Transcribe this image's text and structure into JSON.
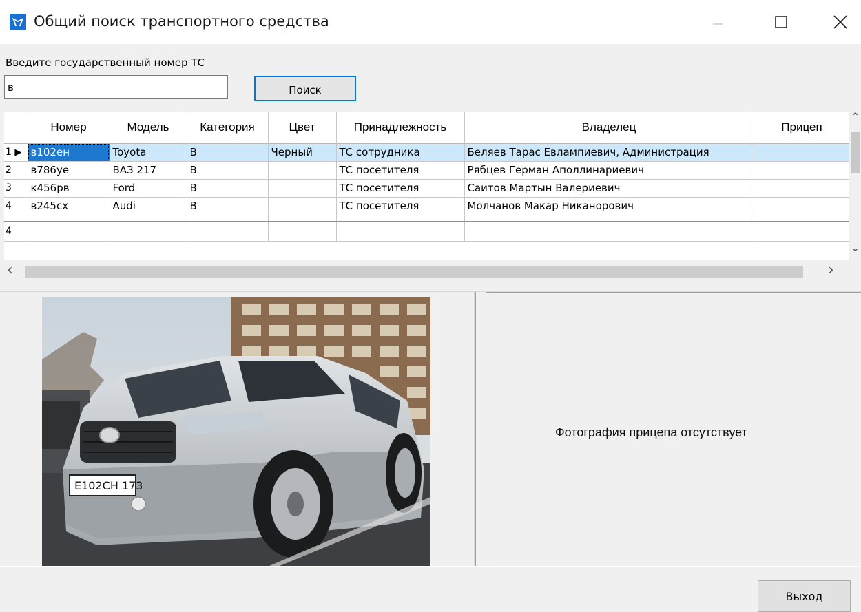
{
  "window": {
    "title": "Общий поиск транспортного средства",
    "min_icon": "minimize-icon",
    "max_icon": "maximize-icon",
    "close_icon": "close-icon",
    "accent": "#0078d7"
  },
  "search": {
    "label": "Введите государственный номер ТС",
    "value": "в",
    "button_label": "Поиск"
  },
  "grid": {
    "columns": [
      "Номер",
      "Модель",
      "Категория",
      "Цвет",
      "Принадлежность",
      "Владелец",
      "Прицеп"
    ],
    "rows": [
      {
        "num": "1",
        "plate": "в102ен",
        "model": "Toyota",
        "category": "B",
        "color": "Черный",
        "belonging": "ТС сотрудника",
        "owner": "Беляев Тарас Евлампиевич, Администрация",
        "trailer": ""
      },
      {
        "num": "2",
        "plate": "в786уе",
        "model": "ВАЗ 217",
        "category": "B",
        "color": "",
        "belonging": "ТС посетителя",
        "owner": "Рябцев Герман Аполлинариевич",
        "trailer": ""
      },
      {
        "num": "3",
        "plate": "к456рв",
        "model": "Ford",
        "category": "B",
        "color": "",
        "belonging": "ТС посетителя",
        "owner": "Саитов Мартын Валериевич",
        "trailer": ""
      },
      {
        "num": "4",
        "plate": "в245сх",
        "model": "Audi",
        "category": "B",
        "color": "",
        "belonging": "ТС посетителя",
        "owner": "Молчанов Макар Никанорович",
        "trailer": ""
      }
    ],
    "footer_count": "4",
    "selected_row_color": "#cde8fb",
    "active_cell_color": "#1e78d0"
  },
  "photo": {
    "plate_text": "Е102СН 173"
  },
  "trailer_photo": {
    "message": "Фотография прицепа отсутствует"
  },
  "footer": {
    "exit_label": "Выход"
  }
}
